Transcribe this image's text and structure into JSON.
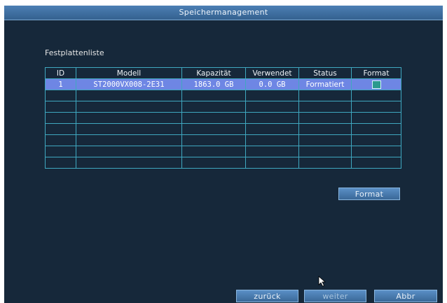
{
  "window": {
    "title": "Speichermanagement"
  },
  "section": {
    "title": "Festplattenliste"
  },
  "table": {
    "columns": [
      "ID",
      "Modell",
      "Kapazität",
      "Verwendet",
      "Status",
      "Format"
    ],
    "rows": [
      {
        "id": "1",
        "model": "ST2000VX008-2E31",
        "capacity": "1863.0 GB",
        "used": "0.0 GB",
        "status": "Formatiert",
        "format_checked": true
      }
    ],
    "empty_rows": 7
  },
  "buttons": {
    "format": "Format",
    "back": "zurück",
    "next": "weiter",
    "cancel": "Abbr"
  },
  "colors": {
    "background": "#16283a",
    "selected_row": "#6e86e4",
    "grid_line": "#3fa8c0",
    "button": "#4a7db2"
  },
  "icons": {
    "cursor": "mouse-pointer-icon",
    "checkbox": "checkbox-icon"
  }
}
